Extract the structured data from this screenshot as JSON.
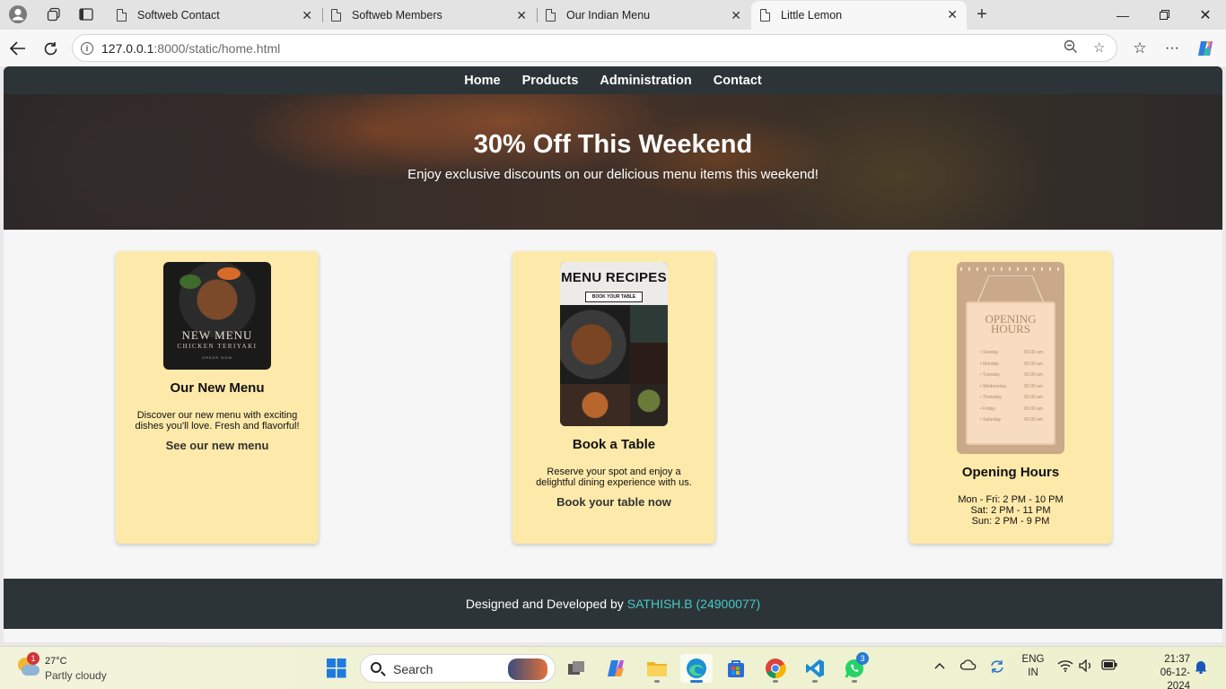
{
  "browser": {
    "tabs": [
      {
        "title": "Softweb Contact",
        "active": false
      },
      {
        "title": "Softweb Members",
        "active": false
      },
      {
        "title": "Our Indian Menu",
        "active": false
      },
      {
        "title": "Little Lemon",
        "active": true
      }
    ],
    "url_host": "127.0.0.1",
    "url_rest": ":8000/static/home.html",
    "icons": [
      "profile-icon",
      "workspaces-icon",
      "tab-actions-icon",
      "back-icon",
      "reload-icon",
      "site-info-icon",
      "zoom-icon",
      "favorite-icon",
      "favorites-icon",
      "more-icon",
      "copilot-icon"
    ]
  },
  "site": {
    "nav": [
      "Home",
      "Products",
      "Administration",
      "Contact"
    ],
    "hero": {
      "title": "30% Off This Weekend",
      "subtitle": "Enjoy exclusive discounts on our delicious menu items this weekend!"
    },
    "cards": [
      {
        "title": "Our New Menu",
        "description": "Discover our new menu with exciting dishes you'll love. Fresh and flavorful!",
        "link": "See our new menu",
        "image_text": {
          "title": "NEW MENU",
          "subtitle": "CHICKEN TERIYAKI",
          "note": "ORDER NOW"
        }
      },
      {
        "title": "Book a Table",
        "description": "Reserve your spot and enjoy a delightful dining experience with us.",
        "link": "Book your table now",
        "image_text": {
          "title": "MENU RECIPES",
          "banner": "BOOK YOUR TABLE"
        }
      },
      {
        "title": "Opening Hours",
        "hours": [
          "Mon - Fri: 2 PM - 10 PM",
          "Sat: 2 PM - 11 PM",
          "Sun: 2 PM - 9 PM"
        ],
        "image_text": {
          "title_1": "OPENING",
          "title_2": "HOURS",
          "rows": [
            {
              "day": "• Sunday",
              "time": "00.00 am"
            },
            {
              "day": "• Monday",
              "time": "00.00 am"
            },
            {
              "day": "• Tuesday",
              "time": "00.00 am"
            },
            {
              "day": "• Wednesday",
              "time": "00.00 am"
            },
            {
              "day": "• Thursday",
              "time": "00.00 am"
            },
            {
              "day": "• Friday",
              "time": "00.00 am"
            },
            {
              "day": "• Saturday",
              "time": "00.00 am"
            }
          ]
        }
      }
    ],
    "footer": {
      "text": "Designed and Developed by",
      "author": "SATHISH.B (24900077)"
    },
    "colors": {
      "nav_bg": "#2c3437",
      "card_bg": "#fde9a9",
      "author": "#46c9c7"
    }
  },
  "taskbar": {
    "weather": {
      "temp": "27°C",
      "condition": "Partly cloudy",
      "badge": "1"
    },
    "search_label": "Search",
    "whatsapp_badge": "3",
    "lang": {
      "line1": "ENG",
      "line2": "IN"
    },
    "time": "21:37",
    "date": "06-12-2024"
  }
}
